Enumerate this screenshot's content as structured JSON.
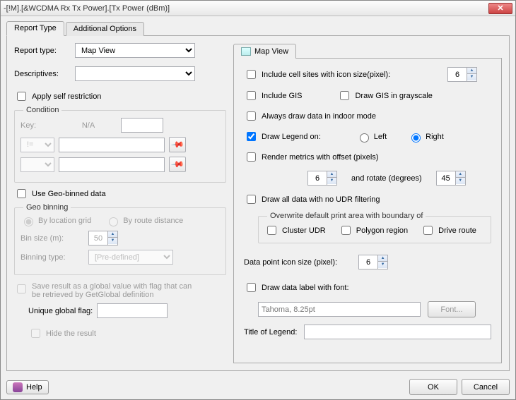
{
  "window": {
    "title": "-[!M].[&WCDMA Rx Tx Power].[Tx Power (dBm)]"
  },
  "tabs": {
    "report_type": "Report Type",
    "additional": "Additional Options"
  },
  "left": {
    "report_type_label": "Report type:",
    "report_type_value": "Map View",
    "descriptives_label": "Descriptives:",
    "descriptives_value": "",
    "apply_self_restriction": "Apply self restriction",
    "condition": {
      "legend": "Condition",
      "key_label": "Key:",
      "key_value": "N/A",
      "op_value": "!="
    },
    "use_geo": "Use Geo-binned data",
    "geo": {
      "legend": "Geo binning",
      "by_location": "By location grid",
      "by_route": "By route distance",
      "bin_size_label": "Bin size (m):",
      "bin_size_value": "50",
      "binning_type_label": "Binning type:",
      "binning_type_value": "[Pre-defined]"
    },
    "save_result": "Save result as a global value with flag that can be retrieved by GetGlobal definition",
    "unique_flag_label": "Unique global flag:",
    "hide_result": "Hide the result"
  },
  "right": {
    "tab_label": "Map View",
    "include_cell_sites": "Include cell sites with icon size(pixel):",
    "icon_size1": "6",
    "include_gis": "Include GIS",
    "draw_gis_gray": "Draw GIS in grayscale",
    "always_indoor": "Always draw data in indoor mode",
    "draw_legend_on": "Draw Legend on:",
    "left": "Left",
    "right_opt": "Right",
    "render_offset": "Render metrics with offset (pixels)",
    "offset_val": "6",
    "rotate_label": "and rotate (degrees)",
    "rotate_val": "45",
    "no_udr": "Draw all data with no UDR filtering",
    "overwrite_legend": "Overwrite default print area with boundary of",
    "cluster_udr": "Cluster UDR",
    "polygon": "Polygon region",
    "drive_route": "Drive route",
    "data_point_label": "Data point icon size (pixel):",
    "data_point_val": "6",
    "draw_label_font": "Draw data label with font:",
    "font_value": "Tahoma, 8.25pt",
    "font_btn": "Font...",
    "title_legend_label": "Title of Legend:",
    "title_legend_value": ""
  },
  "footer": {
    "help": "Help",
    "ok": "OK",
    "cancel": "Cancel"
  }
}
